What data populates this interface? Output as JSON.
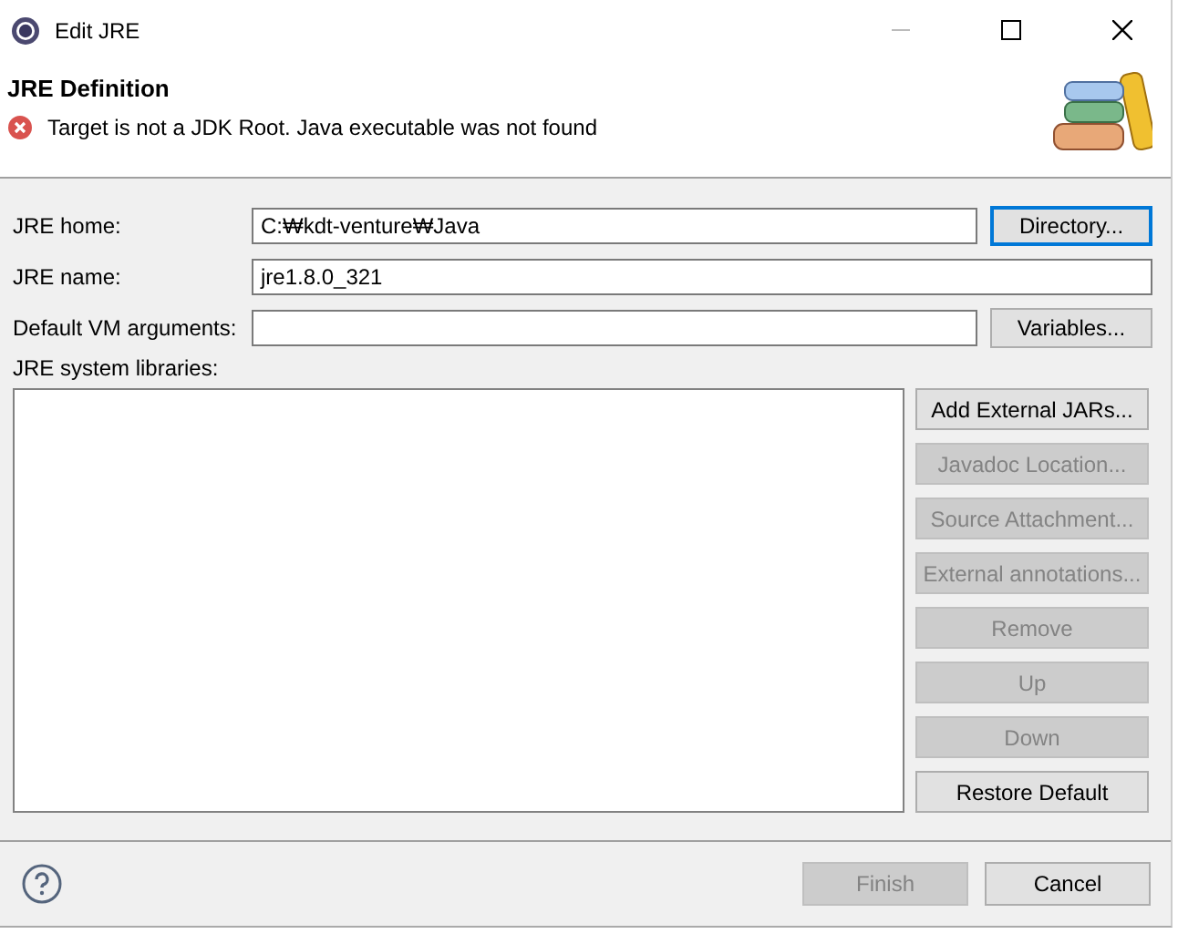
{
  "window": {
    "title": "Edit JRE"
  },
  "header": {
    "title": "JRE Definition",
    "message": "Target is not a JDK Root. Java executable was not found"
  },
  "fields": [
    {
      "label": "JRE home:",
      "value": "C:₩kdt-venture₩Java",
      "button": {
        "label": "Directory...",
        "focused": true
      }
    },
    {
      "label": "JRE name:",
      "value": "jre1.8.0_321"
    },
    {
      "label": "Default VM arguments:",
      "button": {
        "label": "Variables...",
        "focused": false
      }
    }
  ],
  "libraries": {
    "label": "JRE system libraries:",
    "buttons": [
      {
        "label": "Add External JARs...",
        "disabled": false
      },
      {
        "label": "Javadoc Location...",
        "disabled": true
      },
      {
        "label": "Source Attachment...",
        "disabled": true
      },
      {
        "label": "External annotations...",
        "disabled": true
      },
      {
        "label": "Remove",
        "disabled": true
      },
      {
        "label": "Up",
        "disabled": true
      },
      {
        "label": "Down",
        "disabled": true
      },
      {
        "label": "Restore Default",
        "disabled": false
      }
    ]
  },
  "footer": {
    "buttons": [
      {
        "label": "Finish",
        "disabled": true
      },
      {
        "label": "Cancel",
        "disabled": false
      }
    ]
  }
}
